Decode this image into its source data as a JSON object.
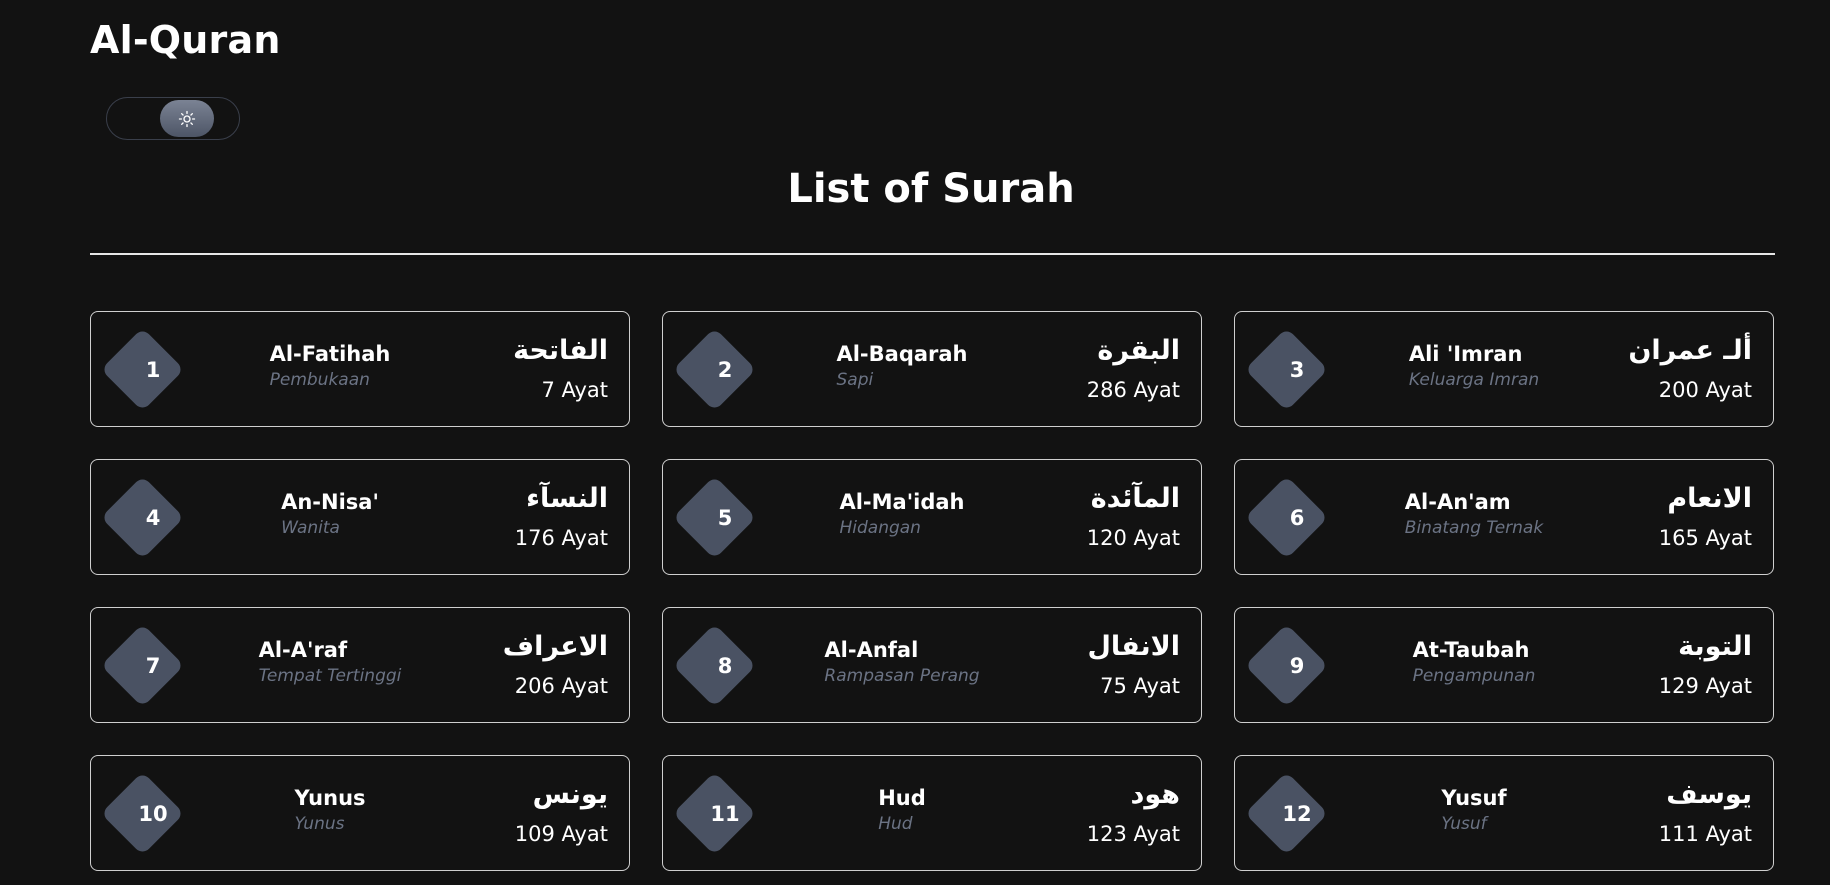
{
  "app": {
    "title": "Al-Quran"
  },
  "theme_toggle": {
    "icon": "sun-icon"
  },
  "section": {
    "title": "List of Surah"
  },
  "colors": {
    "background": "#121212",
    "badge": "#4a5263",
    "muted_text": "#6b7384",
    "card_border": "#cfcfcf"
  },
  "surahs": [
    {
      "number": "1",
      "name": "Al-Fatihah",
      "meaning": "Pembukaan",
      "arabic": "الفاتحة",
      "ayat": "7 Ayat"
    },
    {
      "number": "2",
      "name": "Al-Baqarah",
      "meaning": "Sapi",
      "arabic": "البقرة",
      "ayat": "286 Ayat"
    },
    {
      "number": "3",
      "name": "Ali 'Imran",
      "meaning": "Keluarga Imran",
      "arabic": "ألـ عمران",
      "ayat": "200 Ayat"
    },
    {
      "number": "4",
      "name": "An-Nisa'",
      "meaning": "Wanita",
      "arabic": "النسآء",
      "ayat": "176 Ayat"
    },
    {
      "number": "5",
      "name": "Al-Ma'idah",
      "meaning": "Hidangan",
      "arabic": "المآئدة",
      "ayat": "120 Ayat"
    },
    {
      "number": "6",
      "name": "Al-An'am",
      "meaning": "Binatang Ternak",
      "arabic": "الانعام",
      "ayat": "165 Ayat"
    },
    {
      "number": "7",
      "name": "Al-A'raf",
      "meaning": "Tempat Tertinggi",
      "arabic": "الاعراف",
      "ayat": "206 Ayat"
    },
    {
      "number": "8",
      "name": "Al-Anfal",
      "meaning": "Rampasan Perang",
      "arabic": "الانفال",
      "ayat": "75 Ayat"
    },
    {
      "number": "9",
      "name": "At-Taubah",
      "meaning": "Pengampunan",
      "arabic": "التوبة",
      "ayat": "129 Ayat"
    },
    {
      "number": "10",
      "name": "Yunus",
      "meaning": "Yunus",
      "arabic": "يونس",
      "ayat": "109 Ayat"
    },
    {
      "number": "11",
      "name": "Hud",
      "meaning": "Hud",
      "arabic": "هود",
      "ayat": "123 Ayat"
    },
    {
      "number": "12",
      "name": "Yusuf",
      "meaning": "Yusuf",
      "arabic": "يوسف",
      "ayat": "111 Ayat"
    }
  ]
}
